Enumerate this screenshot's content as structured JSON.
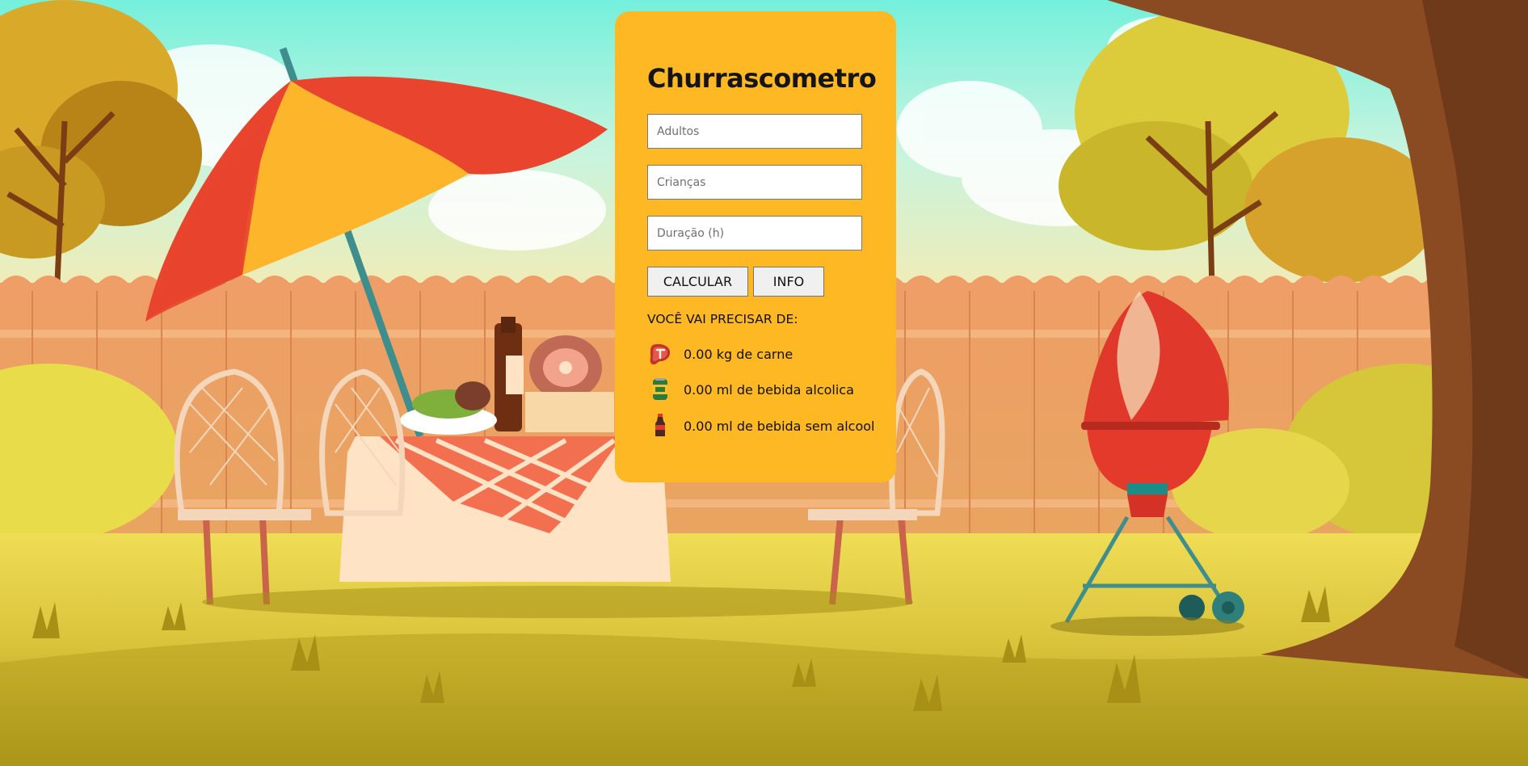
{
  "app": {
    "title": "Churrascometro"
  },
  "form": {
    "adults_placeholder": "Adultos",
    "children_placeholder": "Crianças",
    "duration_placeholder": "Duração (h)",
    "calculate_label": "CALCULAR",
    "info_label": "INFO"
  },
  "results": {
    "heading": "VOCÊ VAI PRECISAR DE:",
    "items": [
      {
        "icon": "meat-icon",
        "text": "0.00 kg de carne"
      },
      {
        "icon": "beer-can-icon",
        "text": "0.00 ml de bebida alcolica"
      },
      {
        "icon": "soda-bottle-icon",
        "text": "0.00 ml de bebida sem alcool"
      }
    ]
  },
  "colors": {
    "panel": "#FDB823",
    "sky_top": "#7CEFD8",
    "fence": "#E8915A",
    "grass": "#D9C53C",
    "grill": "#E43A2C",
    "tablecloth": "#F05A3C"
  }
}
